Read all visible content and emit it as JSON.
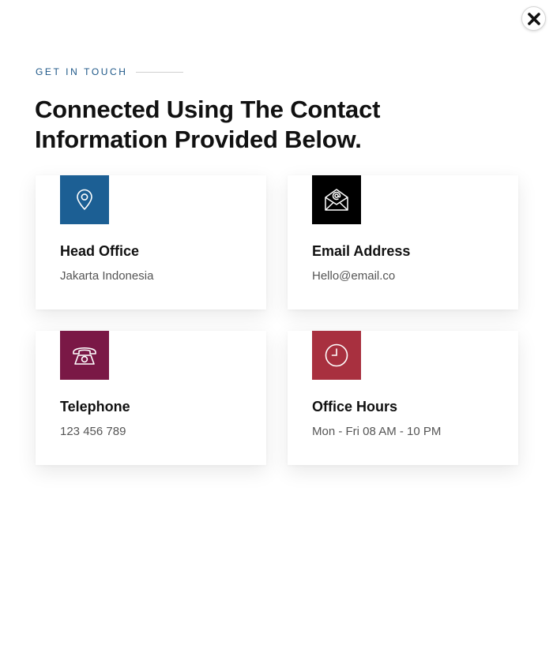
{
  "close": {
    "icon": "close-icon"
  },
  "header": {
    "eyebrow": "GET IN TOUCH",
    "headline_line1": "Connected Using The Contact",
    "headline_line2": "Information Provided Below."
  },
  "cards": [
    {
      "title": "Head Office",
      "value": "Jakarta Indonesia",
      "icon": "location-pin-icon",
      "color": "#1c5f94"
    },
    {
      "title": "Email Address",
      "value": "Hello@email.co",
      "icon": "envelope-icon",
      "color": "#000000"
    },
    {
      "title": "Telephone",
      "value": "123 456 789",
      "icon": "telephone-icon",
      "color": "#7a1846"
    },
    {
      "title": "Office Hours",
      "value": "Mon - Fri 08 AM - 10 PM",
      "icon": "clock-icon",
      "color": "#a8303f"
    }
  ],
  "colors": {
    "accent": "#1c5687",
    "text": "#111111",
    "muted": "#555555"
  }
}
